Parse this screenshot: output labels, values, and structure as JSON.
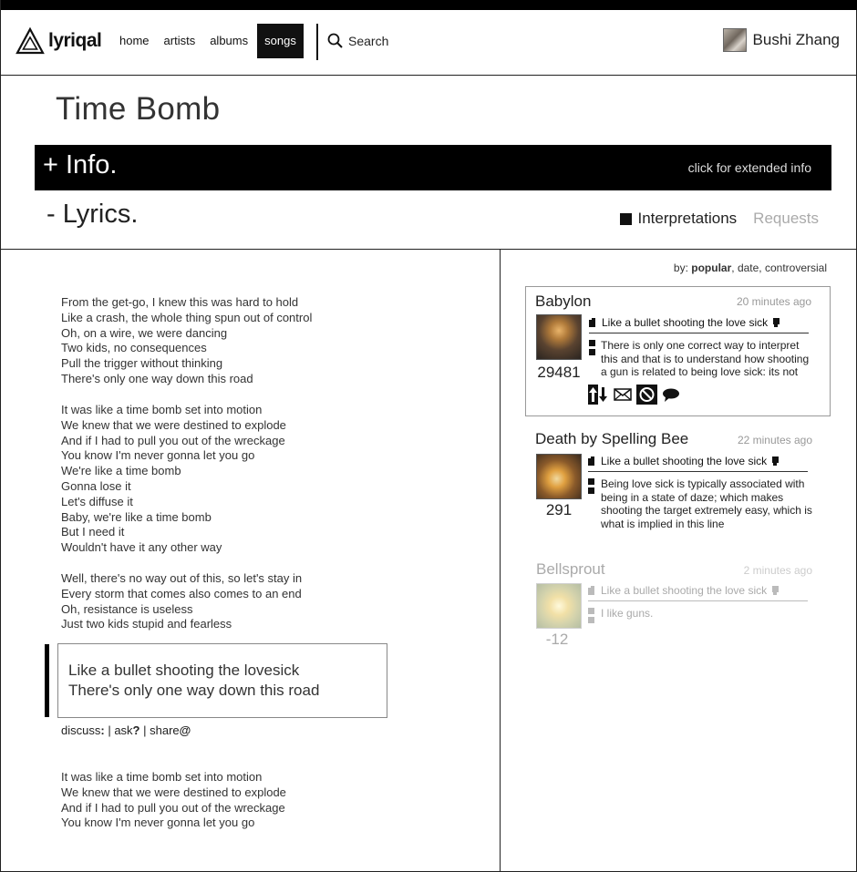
{
  "app": {
    "logo_text": "lyriqal"
  },
  "nav": {
    "items": [
      {
        "label": "home"
      },
      {
        "label": "artists"
      },
      {
        "label": "albums"
      },
      {
        "label": "songs"
      }
    ],
    "search_label": "Search",
    "user_name": "Bushi Zhang"
  },
  "song": {
    "title": "Time Bomb"
  },
  "info": {
    "label": "+ Info.",
    "hint": "click for extended info"
  },
  "lyrics_section": {
    "label": "- Lyrics.",
    "tabs": {
      "interpretations": "Interpretations",
      "requests": "Requests"
    }
  },
  "lyrics": {
    "stanza1": [
      "From the get-go, I knew this was hard to hold",
      "Like a crash, the whole thing spun out of control",
      "Oh, on a wire, we were dancing",
      "Two kids, no consequences",
      "Pull the trigger without thinking",
      "There's only one way down this road"
    ],
    "stanza2": [
      "It was like a time bomb set into motion",
      "We knew that we were destined to explode",
      "And if I had to pull you out of the wreckage",
      "You know I'm never gonna let you go",
      "We're like a time bomb",
      "Gonna lose it",
      "Let's diffuse it",
      "Baby, we're like a time bomb",
      "But I need it",
      "Wouldn't have it any other way"
    ],
    "stanza3": [
      "Well, there's no way out of this, so let's stay in",
      "Every storm that comes also comes to an end",
      "Oh, resistance is useless",
      "Just two kids stupid and fearless"
    ],
    "highlight": [
      "Like a bullet shooting the lovesick",
      "There's only one way down this road"
    ],
    "stanza4": [
      "It was like a time bomb set into motion",
      "We knew that we were destined to explode",
      "And if I had to pull you out of the wreckage",
      "You know I'm never gonna let you go"
    ]
  },
  "discuss": {
    "discuss": "discuss",
    "ask": "ask",
    "share": "share"
  },
  "sort": {
    "prefix": "by:",
    "popular": "popular",
    "date": "date",
    "controversial": "controversial"
  },
  "interpretations": [
    {
      "user": "Babylon",
      "time": "20 minutes ago",
      "score": "29481",
      "quote": "Like a bullet shooting the love sick",
      "body": "There is only one correct way to interpret this and that is to understand how shooting a gun is related to being love sick: its not"
    },
    {
      "user": "Death by Spelling Bee",
      "time": "22 minutes ago",
      "score": "291",
      "quote": "Like a bullet shooting the love sick",
      "body": "Being love sick is typically associated with being in a state of daze; which makes shooting the target extremely easy, which is what is implied in this line"
    },
    {
      "user": "Bellsprout",
      "time": "2 minutes ago",
      "score": "-12",
      "quote": "Like a bullet shooting the love sick",
      "body": "I like guns."
    }
  ]
}
